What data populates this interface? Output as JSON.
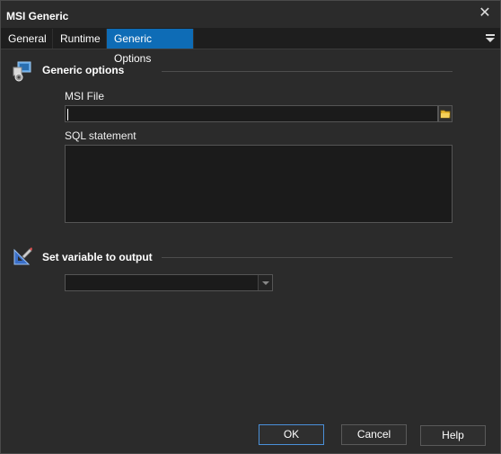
{
  "window": {
    "title": "MSI Generic"
  },
  "tabs": [
    {
      "label": "General"
    },
    {
      "label": "Runtime"
    },
    {
      "label": "Generic Options"
    }
  ],
  "sections": {
    "generic": {
      "title": "Generic options",
      "icon": "msi-package-icon"
    },
    "output": {
      "title": "Set variable to output",
      "icon": "variable-output-icon"
    }
  },
  "fields": {
    "msi_file": {
      "label": "MSI File",
      "value": "",
      "placeholder": ""
    },
    "sql_statement": {
      "label": "SQL statement",
      "value": ""
    },
    "output_variable": {
      "value": ""
    }
  },
  "buttons": {
    "ok": "OK",
    "cancel": "Cancel",
    "help": "Help"
  },
  "colors": {
    "accent": "#0e6cb6",
    "background": "#2b2b2b",
    "input": "#1b1b1b"
  }
}
